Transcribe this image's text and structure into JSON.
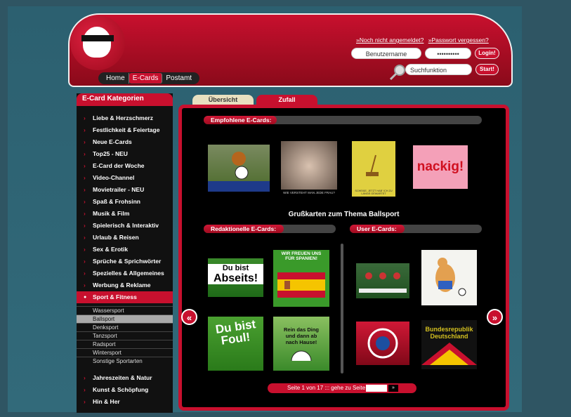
{
  "header": {
    "links": [
      "»Noch nicht angemeldet?",
      "»Passwort vergessen?"
    ],
    "username_placeholder": "Benutzername",
    "password_value": "••••••••••",
    "login_label": "Login!",
    "search_placeholder": "Suchfunktion",
    "search_button": "Start!",
    "nav": [
      "Home",
      "E-Cards",
      "Postamt"
    ]
  },
  "sidebar": {
    "title": "E-Card Kategorien",
    "categories": [
      "Liebe & Herzschmerz",
      "Festlichkeit & Feiertage",
      "Neue E-Cards",
      "Top25 - NEU",
      "E-Card der Woche",
      "Video-Channel",
      "Movietrailer - NEU",
      "Spaß & Frohsinn",
      "Musik & Film",
      "Spielerisch & Interaktiv",
      "Urlaub & Reisen",
      "Sex & Erotik",
      "Sprüche & Sprichwörter",
      "Spezielles & Allgemeines",
      "Werbung & Reklame"
    ],
    "active_category": "Sport & Fitness",
    "subcategories": [
      "Wassersport",
      "Ballsport",
      "Denksport",
      "Tanzsport",
      "Radsport",
      "Wintersport",
      "Sonstige Sportarten"
    ],
    "more_categories": [
      "Jahreszeiten & Natur",
      "Kunst & Schöpfung",
      "Hin & Her"
    ]
  },
  "tabs": [
    "Übersicht",
    "Zufall"
  ],
  "main": {
    "recommended_title": "Empfohlene E-Cards:",
    "heading": "Grußkarten zum Thema Ballsport",
    "editorial_title": "Redaktionelle E-Cards:",
    "user_title": "User E-Cards:",
    "thumb_texts": {
      "t2": "WIE VERSTEHT MAN JEDE FRAU?",
      "t3": "SCHEIßE, JETZT HAB' ICH ZU LANGE GEWARTET",
      "t4": "nackig!",
      "e1": [
        "Du bist",
        "Abseits!"
      ],
      "e2": [
        "WIR FREUEN UNS",
        "FÜR SPANIEN!"
      ],
      "e3": [
        "Du bist",
        "Foul!"
      ],
      "e4": [
        "Rein das Ding",
        "und dann ab",
        "nach Hause!"
      ],
      "u4": [
        "Bundesrepublik",
        "Deutschland"
      ]
    },
    "pager_text": "Seite 1 von 17 ::: gehe zu Seite",
    "pager_button": "»"
  },
  "colors": {
    "brand_red": "#c8102e",
    "background": "#2f5563"
  }
}
